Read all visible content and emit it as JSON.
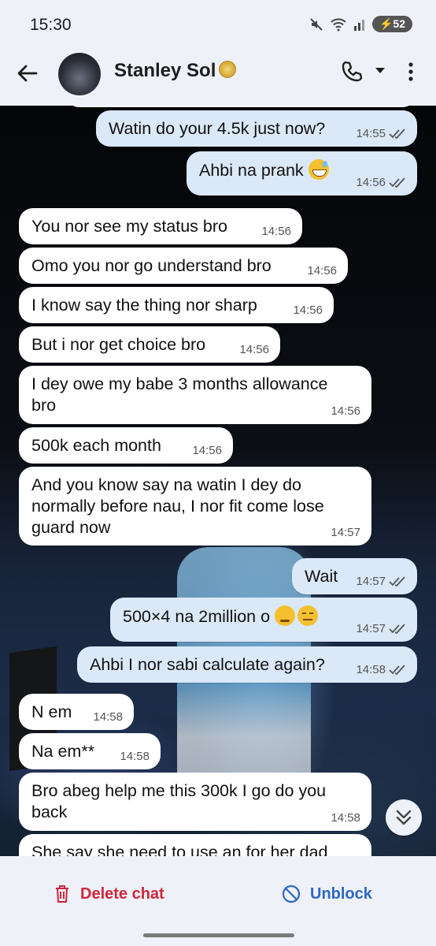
{
  "status_bar": {
    "time": "15:30",
    "battery": "52",
    "icons": [
      "mute-icon",
      "wifi-icon",
      "signal-icon",
      "battery-icon"
    ]
  },
  "header": {
    "contact_name": "Stanley Sol",
    "emoji_icon": "coin-icon"
  },
  "messages": [
    {
      "dir": "out",
      "text": "Watin do your 4.5k just now?",
      "time": "14:55"
    },
    {
      "dir": "out",
      "text": "Ahbi na prank",
      "emoji": "grinning-sweat-emoji",
      "time": "14:56"
    },
    {
      "dir": "in",
      "text": "You nor see my status bro",
      "time": "14:56"
    },
    {
      "dir": "in",
      "text": "Omo you nor go understand bro",
      "time": "14:56"
    },
    {
      "dir": "in",
      "text": "I know say the thing nor sharp",
      "time": "14:56"
    },
    {
      "dir": "in",
      "text": "But i nor get choice bro",
      "time": "14:56"
    },
    {
      "dir": "in",
      "line1": "I dey owe my babe 3 months allowance",
      "line2": "bro",
      "time": "14:56"
    },
    {
      "dir": "in",
      "text": "500k each month",
      "time": "14:56"
    },
    {
      "dir": "in",
      "line1": "And you know say na watin I dey do",
      "line2": "normally before nau, I nor fit come lose",
      "line3": "guard now",
      "time": "14:57"
    },
    {
      "dir": "out",
      "text": "Wait",
      "time": "14:57"
    },
    {
      "dir": "out",
      "text": "500×4 na 2million o",
      "emoji": "disappointed-expressionless-emoji",
      "time": "14:57"
    },
    {
      "dir": "out",
      "text": "Ahbi I nor sabi calculate again?",
      "time": "14:58"
    },
    {
      "dir": "in",
      "text": "N em",
      "time": "14:58"
    },
    {
      "dir": "in",
      "text": "Na em**",
      "time": "14:58"
    },
    {
      "dir": "in",
      "line1": "Bro abeg help me this 300k I go do you",
      "line2": "back",
      "time": "14:58"
    },
    {
      "dir": "in",
      "text": "She say she need to use an for her dad"
    }
  ],
  "bottom_bar": {
    "delete_label": "Delete chat",
    "unblock_label": "Unblock"
  },
  "colors": {
    "outgoing_bubble": "#dbe8f8",
    "incoming_bubble": "#ffffff",
    "delete": "#d0263a",
    "unblock": "#2d66c4"
  }
}
